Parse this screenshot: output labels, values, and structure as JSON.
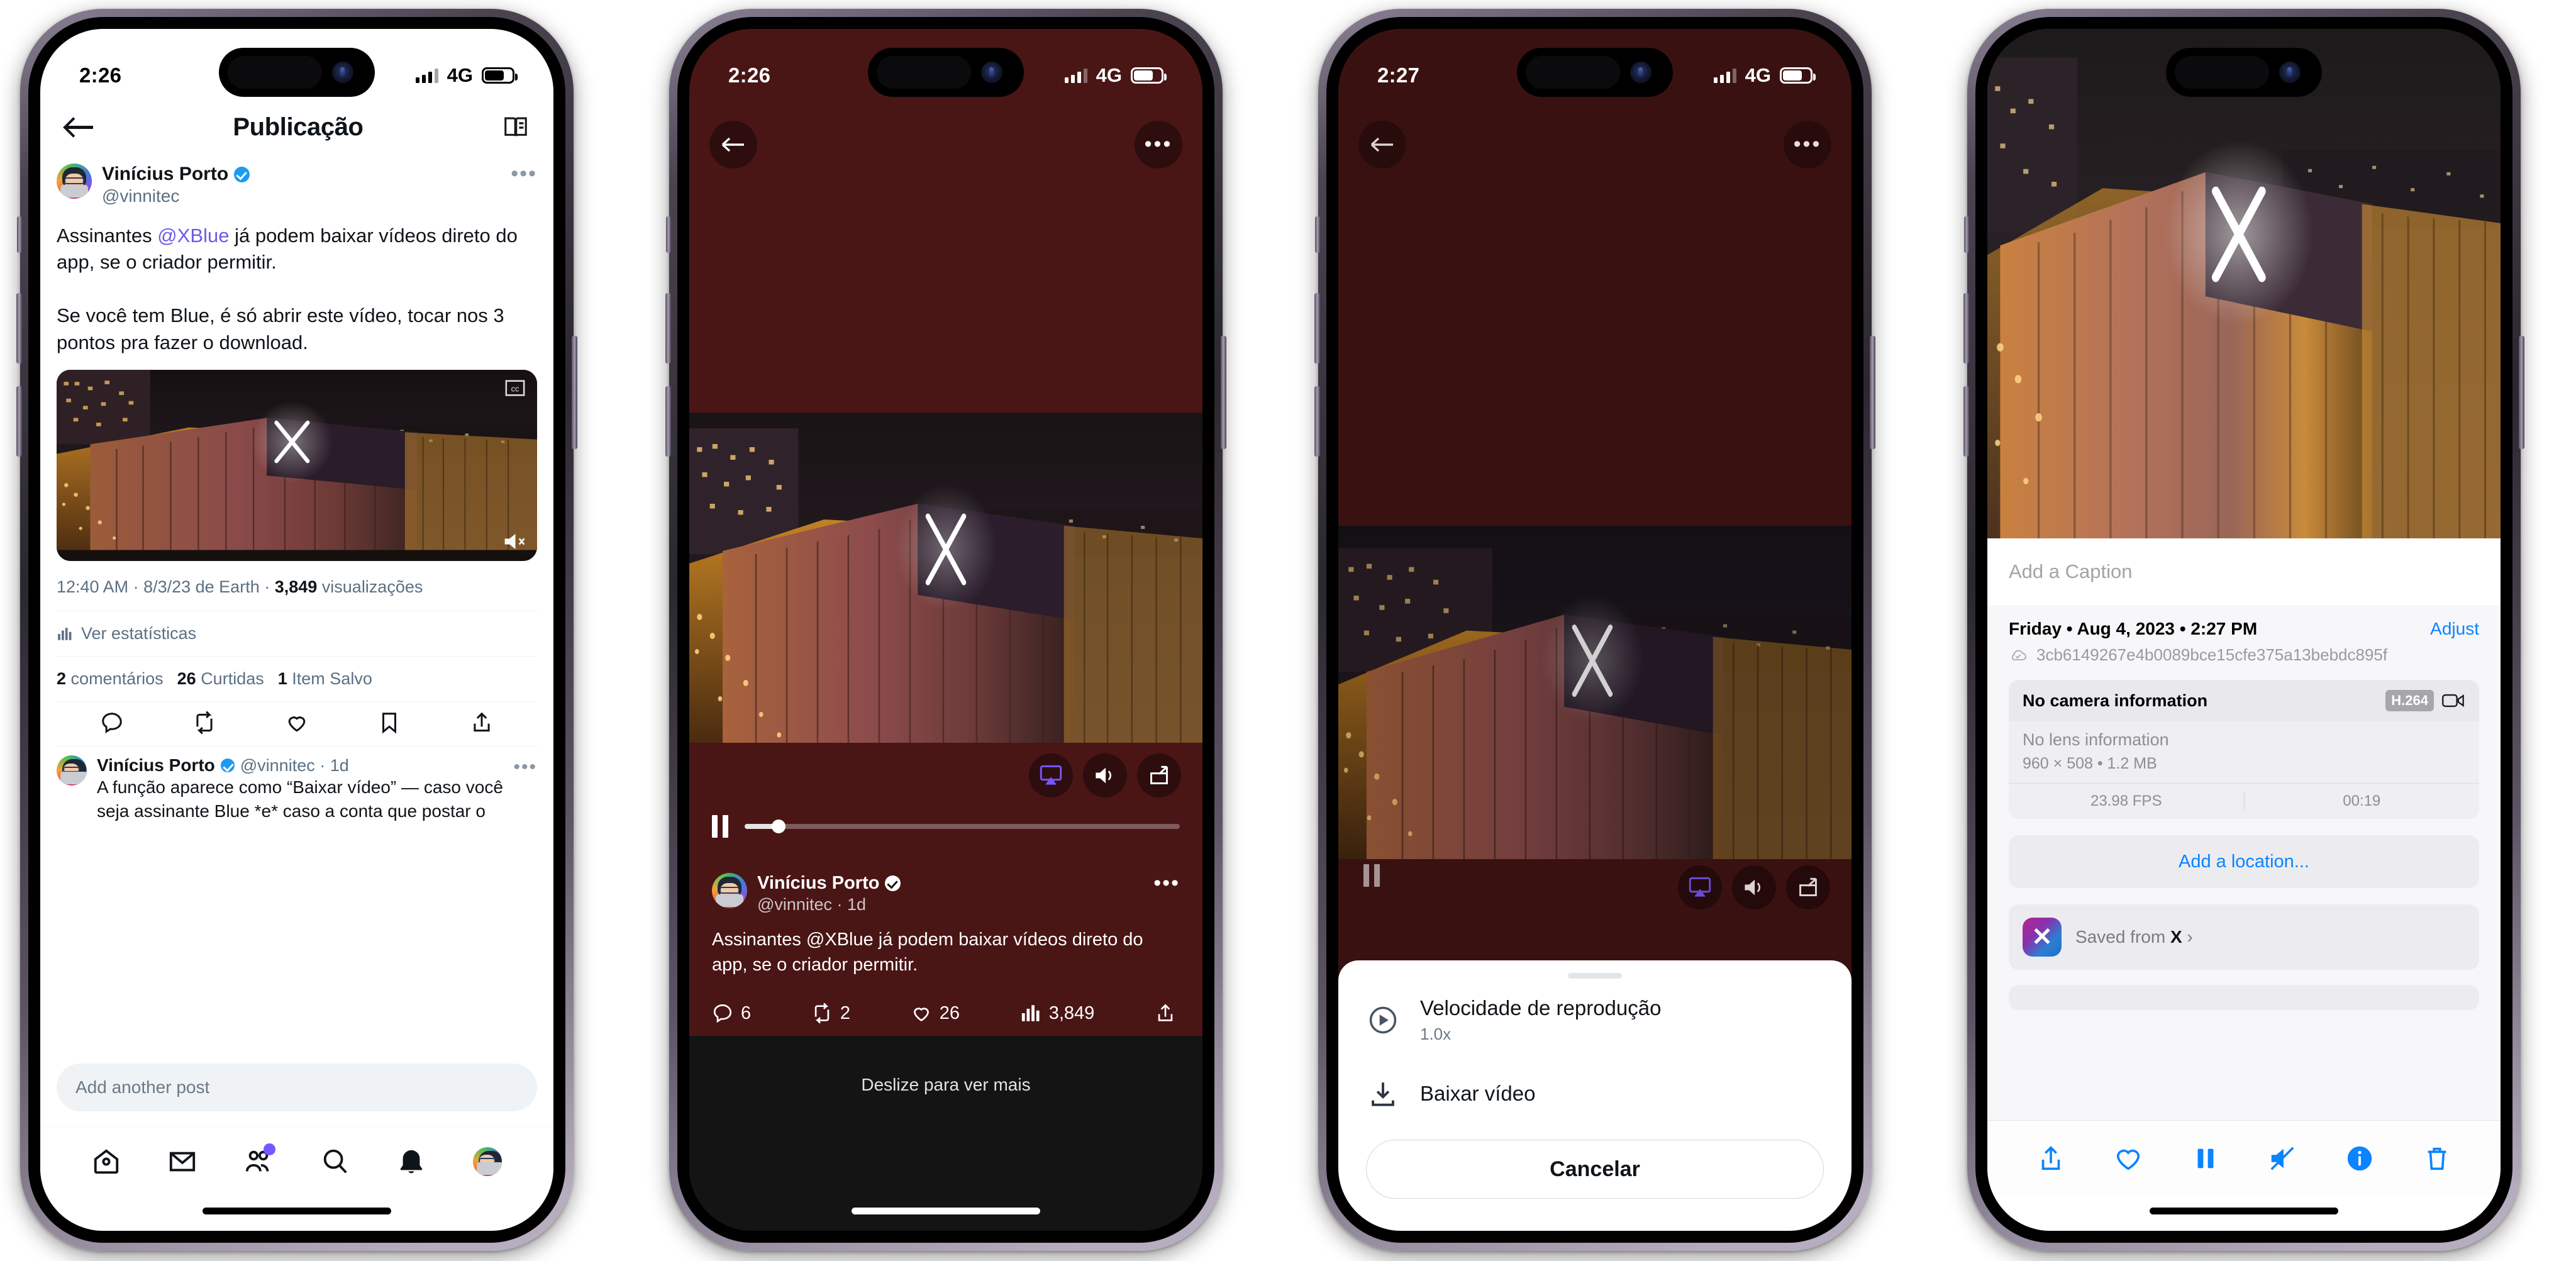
{
  "phones": [
    {
      "id": "phone-1-post-detail",
      "status": {
        "time": "2:26",
        "network": "4G",
        "theme": "dark-on-light"
      },
      "nav": {
        "back": "back-arrow",
        "title": "Publicação",
        "reader": "reader-icon"
      },
      "post": {
        "author_name": "Vinícius Porto",
        "handle": "@vinnitec",
        "verified": true,
        "text_line1": "Assinantes ",
        "mention": "@XBlue",
        "text_line2": " já podem baixar vídeos direto do app, se o criador permitir.",
        "text_line3": "Se você tem Blue, é só abrir este vídeo, tocar nos 3 pontos pra fazer o download.",
        "meta": "12:40 AM · 8/3/23 de Earth · ",
        "meta_views": "3,849",
        "meta_views_label": " visualizações",
        "view_stats": "Ver estatísticas",
        "counts": [
          {
            "n": "2",
            "label": "comentários"
          },
          {
            "n": "26",
            "label": "Curtidas"
          },
          {
            "n": "1",
            "label": "Item Salvo"
          }
        ]
      },
      "reply": {
        "author_name": "Vinícius Porto",
        "handle": "@vinnitec · 1d",
        "text": "A função aparece como “Baixar vídeo” — caso você seja assinante Blue *e* caso a conta que postar o"
      },
      "composer_placeholder": "Add another post",
      "tabs": [
        "home-icon",
        "messages-icon",
        "communities-icon",
        "search-icon",
        "notifications-icon",
        "profile-avatar"
      ]
    },
    {
      "id": "phone-2-video-player",
      "status": {
        "time": "2:26",
        "network": "4G"
      },
      "controls": {
        "back": "back-arrow",
        "more": "more-dots-icon",
        "airplay": "airplay-icon",
        "volume": "volume-icon",
        "pip": "picture-in-picture-icon",
        "pause": "pause-icon",
        "progress_percent": 8
      },
      "post": {
        "author_name": "Vinícius Porto",
        "handle": "@vinnitec · 1d",
        "body": "Assinantes @XBlue já podem baixar vídeos direto do app, se o criador permitir.",
        "actions": [
          {
            "icon": "reply-icon",
            "value": "6"
          },
          {
            "icon": "repost-icon",
            "value": "2"
          },
          {
            "icon": "like-icon",
            "value": "26"
          },
          {
            "icon": "views-icon",
            "value": "3,849"
          },
          {
            "icon": "share-icon",
            "value": ""
          }
        ]
      },
      "swipe_hint": "Deslize para ver mais"
    },
    {
      "id": "phone-3-action-sheet",
      "status": {
        "time": "2:27",
        "network": "4G"
      },
      "controls": {
        "back": "back-arrow",
        "more": "more-dots-icon",
        "airplay": "airplay-icon",
        "volume": "volume-icon",
        "pip": "picture-in-picture-icon"
      },
      "sheet": {
        "items": [
          {
            "icon": "play-speed-icon",
            "title": "Velocidade de reprodução",
            "subtitle": "1.0x"
          },
          {
            "icon": "download-icon",
            "title": "Baixar vídeo",
            "subtitle": ""
          }
        ],
        "cancel": "Cancelar"
      }
    },
    {
      "id": "phone-4-photos-info",
      "caption_placeholder": "Add a Caption",
      "info": {
        "date": "Friday • Aug 4, 2023 • 2:27 PM",
        "adjust": "Adjust",
        "cloud_icon": "cloud-check-icon",
        "asset_id": "3cb6149267e4b0089bce15cfe375a13bebdc895f",
        "camera": "No camera information",
        "codec_chip": "H.264",
        "video_icon": "video-camera-icon",
        "lens": "No lens information",
        "dimensions": "960 × 508  •  1.2 MB",
        "fps": "23.98 FPS",
        "duration": "00:19",
        "add_location": "Add a location...",
        "saved_from_prefix": "Saved from ",
        "saved_from_app": "X",
        "chevron": "›"
      },
      "toolbar": [
        "share-icon",
        "favorite-icon",
        "pause-icon",
        "mute-icon",
        "info-icon",
        "trash-icon"
      ]
    }
  ],
  "colors": {
    "twitter_blue": "#1d9bf0",
    "mention_purple": "#6c5ce7",
    "ios_blue": "#0a84ff",
    "player_bg": "#4a1515",
    "accent_purple": "#7856ff"
  }
}
